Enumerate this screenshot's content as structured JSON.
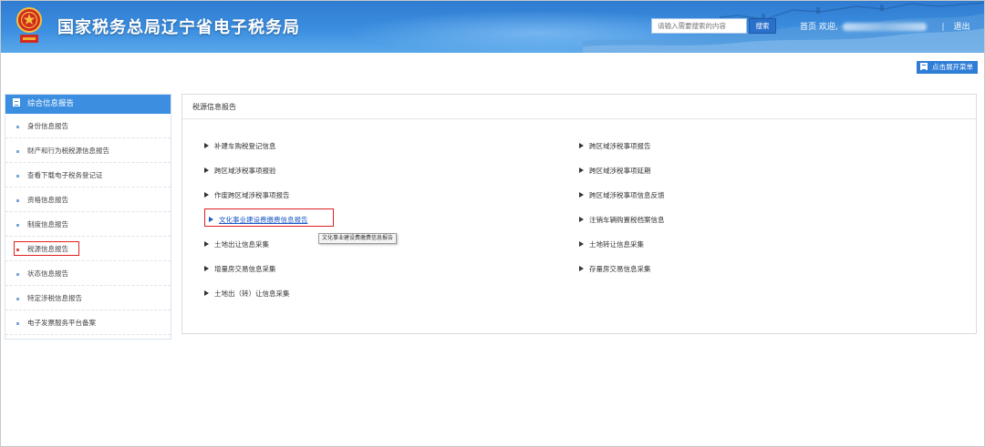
{
  "header": {
    "title": "国家税务总局辽宁省电子税务局",
    "emblem_caption": "中国税务",
    "search_placeholder": "请输入需要搜索的内容",
    "search_button": "搜索",
    "home_link": "首页",
    "welcome_label": "欢迎,",
    "logout_label": "退出",
    "separator": "|"
  },
  "toolbar": {
    "expand_menu_label": "点击展开菜单"
  },
  "sidebar": {
    "title": "综合信息报告",
    "items": [
      {
        "label": "身份信息报告"
      },
      {
        "label": "财产和行为税税源信息报告"
      },
      {
        "label": "查看下载电子税务登记证"
      },
      {
        "label": "资格信息报告"
      },
      {
        "label": "制度信息报告"
      },
      {
        "label": "税源信息报告",
        "active": true
      },
      {
        "label": "状态信息报告"
      },
      {
        "label": "特定涉税信息报告"
      },
      {
        "label": "电子发票服务平台备案"
      }
    ]
  },
  "main": {
    "title": "税源信息报告",
    "left_links": [
      "补建车购税登记信息",
      "跨区域涉税事项报验",
      "作废跨区域涉税事项报告",
      "文化事业建设费缴费信息报告",
      "土地出让信息采集",
      "增量房交易信息采集",
      "土地出（转）让信息采集"
    ],
    "right_links": [
      "跨区域涉税事项报告",
      "跨区域涉税事项延期",
      "跨区域涉税事项信息反馈",
      "注销车辆购置税档案信息",
      "土地转让信息采集",
      "存量房交易信息采集"
    ],
    "tooltip": "文化事业建设费缴费信息报告"
  },
  "colors": {
    "brand_blue": "#3b8ee0",
    "highlight_red": "#e02020",
    "link_blue": "#1a58c4"
  }
}
